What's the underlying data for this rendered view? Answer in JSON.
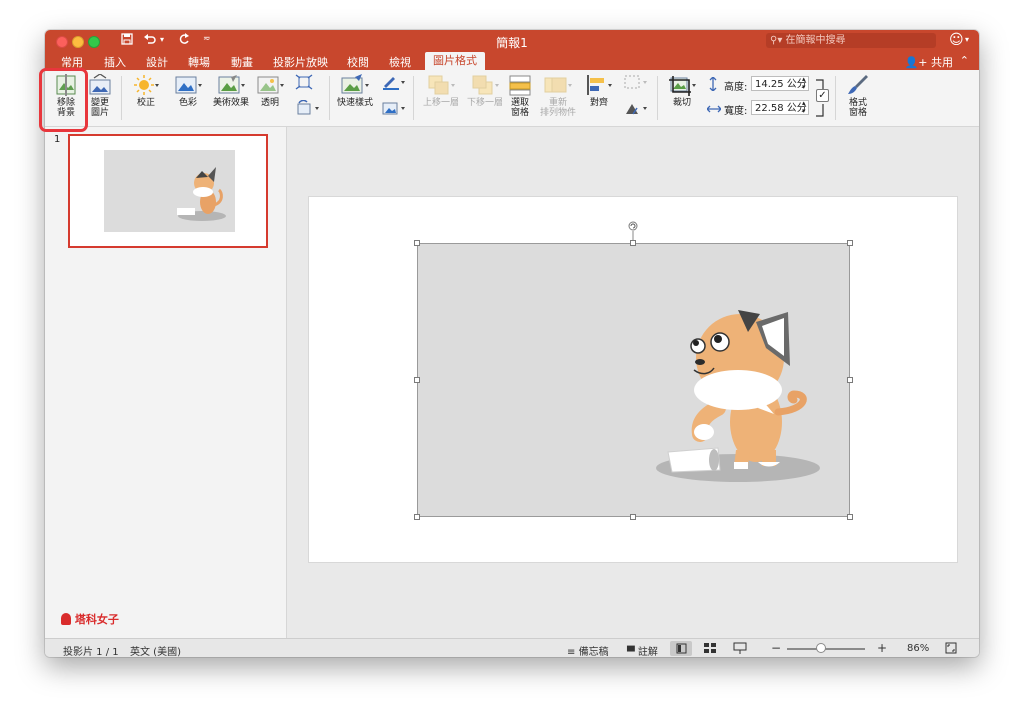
{
  "window": {
    "title": "簡報1",
    "search_placeholder": "在簡報中搜尋"
  },
  "tabs": [
    {
      "label": "常用"
    },
    {
      "label": "插入"
    },
    {
      "label": "設計"
    },
    {
      "label": "轉場"
    },
    {
      "label": "動畫"
    },
    {
      "label": "投影片放映"
    },
    {
      "label": "校閱"
    },
    {
      "label": "檢視"
    },
    {
      "label": "圖片格式",
      "active": true
    }
  ],
  "share_label": "共用",
  "ribbon": {
    "remove_bg": [
      "移除",
      "背景"
    ],
    "change_pic": [
      "變更",
      "圖片"
    ],
    "corrections": "校正",
    "color": "色彩",
    "artistic": "美術效果",
    "transparency": "透明",
    "quick_styles": "快速樣式",
    "bring_forward": "上移一層",
    "send_backward": "下移一層",
    "selection_pane": [
      "選取",
      "窗格"
    ],
    "reorder": [
      "重新",
      "排列物件"
    ],
    "align": "對齊",
    "crop": "裁切",
    "height_label": "高度:",
    "height_value": "14.25 公分",
    "width_label": "寬度:",
    "width_value": "22.58 公分",
    "format_pane": [
      "格式",
      "窗格"
    ]
  },
  "slides_panel": {
    "slide_number": "1",
    "watermark": "塔科女子"
  },
  "status": {
    "slide_info": "投影片 1 / 1",
    "language": "英文 (美國)",
    "notes": "備忘稿",
    "comments": "註解",
    "zoom_minus": "−",
    "zoom_plus": "+",
    "zoom": "86%"
  },
  "colors": {
    "accent": "#c8472d",
    "highlight": "#e8363c",
    "selection": "#d53a2e",
    "image_bg": "#dcdcdc"
  }
}
